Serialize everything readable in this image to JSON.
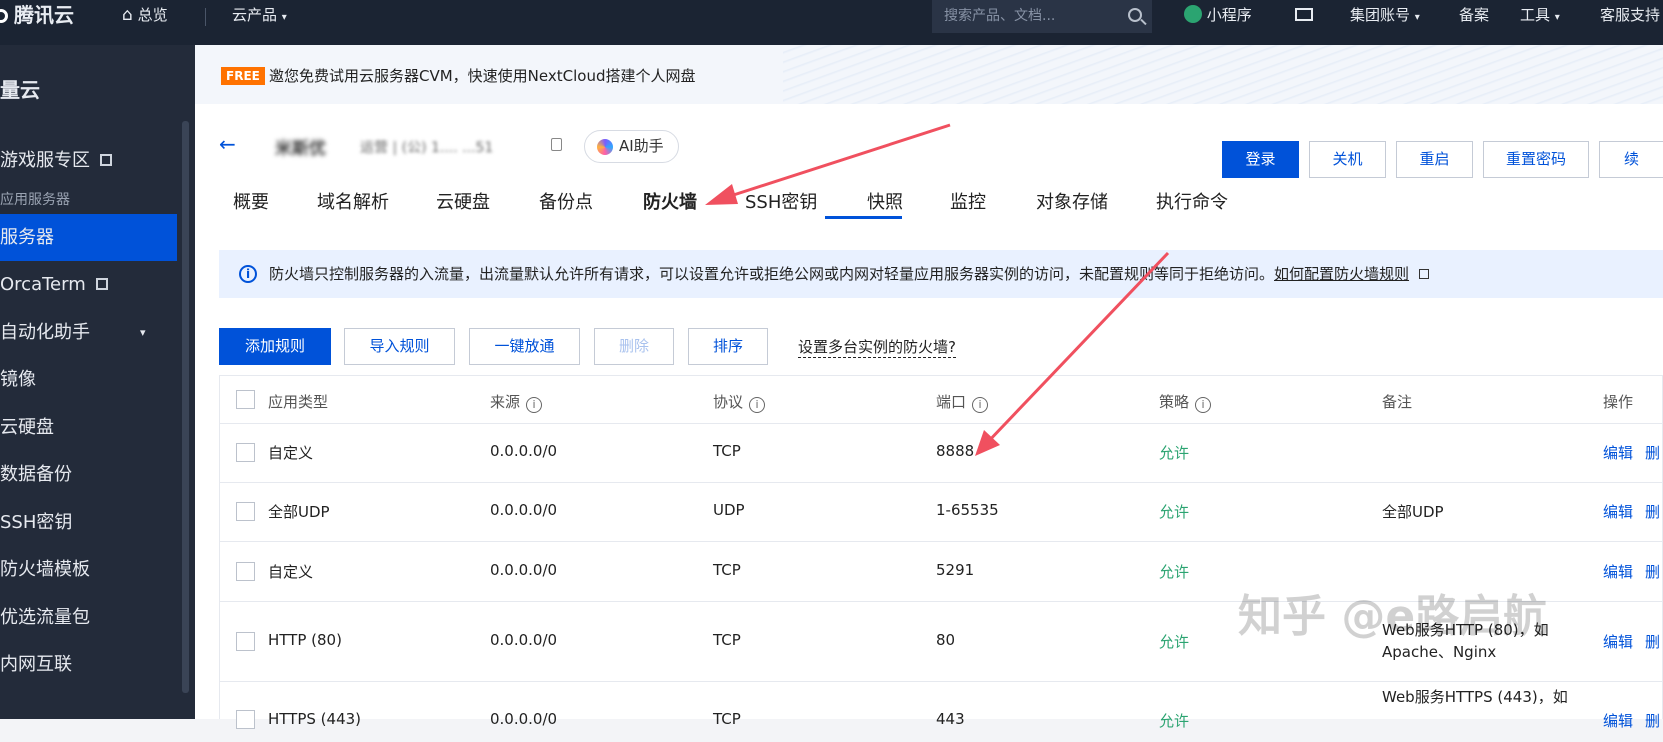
{
  "topbar": {
    "logo": "腾讯云",
    "overview": "总览",
    "products": "云产品",
    "search_placeholder": "搜索产品、文档...",
    "miniprogram": "小程序",
    "group_account": "集团账号",
    "beian": "备案",
    "tools": "工具",
    "support": "客服支持"
  },
  "sidebar": {
    "title": "量云",
    "items": [
      {
        "label": "游戏服专区"
      },
      {
        "label": "服务器"
      },
      {
        "label": "OrcaTerm"
      },
      {
        "label": "自动化助手"
      },
      {
        "label": "镜像"
      },
      {
        "label": "云硬盘"
      },
      {
        "label": "数据备份"
      },
      {
        "label": "SSH密钥"
      },
      {
        "label": "防火墙模板"
      },
      {
        "label": "优选流量包"
      },
      {
        "label": "内网互联"
      }
    ],
    "group_label": "应用服务器"
  },
  "banner": {
    "badge": "FREE",
    "text": "邀您免费试用云服务器CVM，快速使用NextCloud搭建个人网盘"
  },
  "instance": {
    "name": "米斯优",
    "ip": "运营 | (公) 1.... ...51",
    "ai_label": "AI助手"
  },
  "actions": {
    "login": "登录",
    "shutdown": "关机",
    "restart": "重启",
    "reset_password": "重置密码",
    "more": "续"
  },
  "tabs": [
    "概要",
    "域名解析",
    "云硬盘",
    "备份点",
    "防火墙",
    "SSH密钥",
    "快照",
    "监控",
    "对象存储",
    "执行命令"
  ],
  "info": {
    "text": "防火墙只控制服务器的入流量，出流量默认允许所有请求，可以设置允许或拒绝公网或内网对轻量应用服务器实例的访问，未配置规则等同于拒绝访问。",
    "link": "如何配置防火墙规则"
  },
  "buttons": {
    "add_rule": "添加规则",
    "import_rule": "导入规则",
    "one_click": "一键放通",
    "delete": "删除",
    "sort": "排序",
    "multi": "设置多台实例的防火墙?"
  },
  "table": {
    "headers": {
      "app_type": "应用类型",
      "source": "来源",
      "protocol": "协议",
      "port": "端口",
      "policy": "策略",
      "remark": "备注",
      "ops": "操作"
    },
    "rows": [
      {
        "app_type": "自定义",
        "source": "0.0.0.0/0",
        "protocol": "TCP",
        "port": "8888",
        "policy": "允许",
        "remark": "",
        "edit": "编辑",
        "del": "删"
      },
      {
        "app_type": "全部UDP",
        "source": "0.0.0.0/0",
        "protocol": "UDP",
        "port": "1-65535",
        "policy": "允许",
        "remark": "全部UDP",
        "edit": "编辑",
        "del": "删"
      },
      {
        "app_type": "自定义",
        "source": "0.0.0.0/0",
        "protocol": "TCP",
        "port": "5291",
        "policy": "允许",
        "remark": "",
        "edit": "编辑",
        "del": "删"
      },
      {
        "app_type": "HTTP (80)",
        "source": "0.0.0.0/0",
        "protocol": "TCP",
        "port": "80",
        "policy": "允许",
        "remark": "Web服务HTTP (80)，如Apache、Nginx",
        "edit": "编辑",
        "del": "删"
      },
      {
        "app_type": "HTTPS (443)",
        "source": "0.0.0.0/0",
        "protocol": "TCP",
        "port": "443",
        "policy": "允许",
        "remark": "Web服务HTTPS (443)，如",
        "edit": "编辑",
        "del": "删"
      }
    ]
  },
  "watermark": "知乎 @e路启航",
  "colors": {
    "primary": "#0052d9",
    "allow": "#2ba471",
    "annotation_arrow": "#f0505f"
  }
}
